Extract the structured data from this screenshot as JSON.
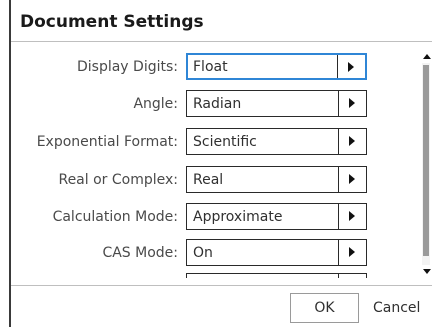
{
  "dialog": {
    "title": "Document Settings"
  },
  "settings": [
    {
      "label": "Display Digits:",
      "value": "Float",
      "focused": true
    },
    {
      "label": "Angle:",
      "value": "Radian",
      "focused": false
    },
    {
      "label": "Exponential Format:",
      "value": "Scientific",
      "focused": false
    },
    {
      "label": "Real or Complex:",
      "value": "Real",
      "focused": false
    },
    {
      "label": "Calculation Mode:",
      "value": "Approximate",
      "focused": false
    },
    {
      "label": "CAS Mode:",
      "value": "On",
      "focused": false
    },
    {
      "label": "",
      "value": "",
      "focused": false
    }
  ],
  "buttons": {
    "ok": "OK",
    "cancel": "Cancel"
  },
  "icons": {
    "dropdown": "chevron-right-icon",
    "scroll_up": "scroll-up-arrow-icon",
    "scroll_down": "scroll-down-arrow-icon"
  },
  "colors": {
    "focus_border": "#2f86d6",
    "label_text": "#4a4a4a",
    "control_border": "#2a2a2a"
  }
}
